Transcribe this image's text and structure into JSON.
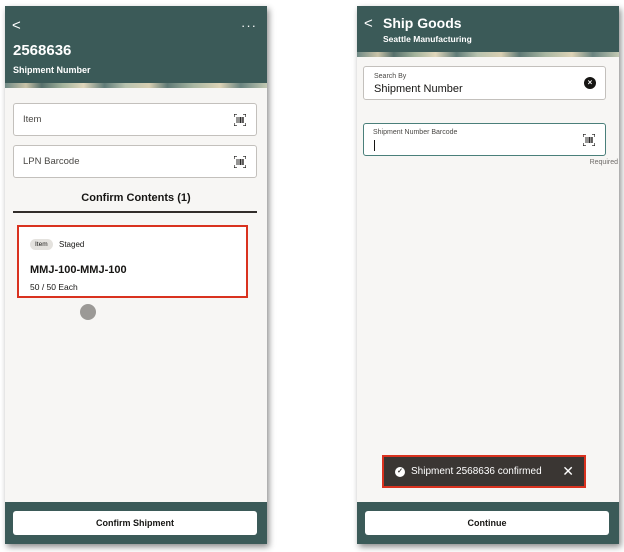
{
  "left_screen": {
    "header": {
      "back_glyph": "<",
      "more_glyph": "···",
      "title": "2568636",
      "subtitle": "Shipment Number"
    },
    "item_field": {
      "placeholder": "Item",
      "icon": "barcode-scan-icon"
    },
    "lpn_field": {
      "placeholder": "LPN Barcode",
      "icon": "barcode-scan-icon"
    },
    "confirm_contents_title": "Confirm Contents (1)",
    "card": {
      "badge": "Item",
      "status": "Staged",
      "title": "MMJ-100-MMJ-100",
      "quantity": "50 / 50 Each"
    },
    "footer_button": "Confirm Shipment"
  },
  "right_screen": {
    "header": {
      "back_glyph": "<",
      "title": "Ship Goods",
      "subtitle": "Seattle Manufacturing"
    },
    "search_by": {
      "label": "Search By",
      "value": "Shipment Number",
      "clear_glyph": "×"
    },
    "barcode_field": {
      "label": "Shipment Number Barcode",
      "value": "",
      "required": "Required",
      "icon": "barcode-scan-icon"
    },
    "toast": {
      "check_glyph": "✓",
      "message": "Shipment 2568636 confirmed",
      "close_glyph": "✕"
    },
    "footer_button": "Continue"
  },
  "colors": {
    "header": "#3b5a58",
    "highlight": "#d9321f",
    "toast_bg": "#3a3633",
    "focus_border": "#4a7f7a"
  }
}
